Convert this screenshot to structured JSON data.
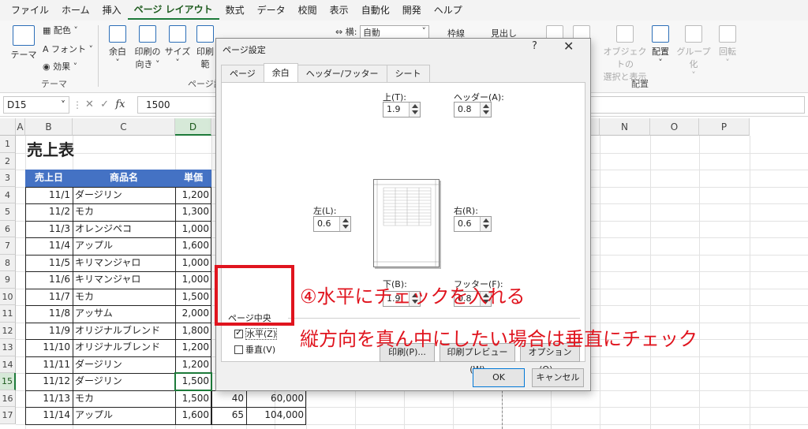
{
  "menu": [
    "ファイル",
    "ホーム",
    "挿入",
    "ページ レイアウト",
    "数式",
    "データ",
    "校閲",
    "表示",
    "自動化",
    "開発",
    "ヘルプ"
  ],
  "menu_active_index": 3,
  "ribbon": {
    "theme": "テーマ",
    "colors": "配色",
    "fonts": "フォント",
    "effects": "効果",
    "theme_group": "テーマ",
    "margins": "余白",
    "orientation_1": "印刷の",
    "orientation_2": "向き",
    "size": "サイズ",
    "print_area": "印刷範",
    "page_setup_group": "ページ設",
    "width_label": "横:",
    "width_value": "自動",
    "gridlines": "枠線",
    "headings": "見出し",
    "selection_pane_1": "オブジェクトの",
    "selection_pane_2": "選択と表示",
    "align": "配置",
    "group": "グループ化",
    "rotate": "回転",
    "arrange_group": "配置"
  },
  "formula_bar": {
    "name_box": "D15",
    "fx": "fx",
    "content": "1500"
  },
  "columns": [
    "A",
    "B",
    "C",
    "D",
    "",
    "",
    "",
    "",
    "",
    "",
    "",
    "",
    "M",
    "N",
    "O",
    "P"
  ],
  "rows": [
    "1",
    "2",
    "3",
    "4",
    "5",
    "6",
    "7",
    "8",
    "9",
    "10",
    "11",
    "12",
    "13",
    "14",
    "15",
    "16",
    "17"
  ],
  "sheet": {
    "title": "売上表",
    "headers": [
      "売上日",
      "商品名",
      "単価"
    ],
    "data": [
      [
        "11/1",
        "ダージリン",
        "1,200"
      ],
      [
        "11/2",
        "モカ",
        "1,300"
      ],
      [
        "11/3",
        "オレンジペコ",
        "1,000"
      ],
      [
        "11/4",
        "アップル",
        "1,600"
      ],
      [
        "11/5",
        "キリマンジャロ",
        "1,000"
      ],
      [
        "11/6",
        "キリマンジャロ",
        "1,000"
      ],
      [
        "11/7",
        "モカ",
        "1,500"
      ],
      [
        "11/8",
        "アッサム",
        "2,000"
      ],
      [
        "11/9",
        "オリジナルブレンド",
        "1,800"
      ],
      [
        "11/10",
        "オリジナルブレンド",
        "1,200"
      ],
      [
        "11/11",
        "ダージリン",
        "1,200"
      ],
      [
        "11/12",
        "ダージリン",
        "1,500"
      ],
      [
        "11/13",
        "モカ",
        "1,500"
      ],
      [
        "11/14",
        "アップル",
        "1,600"
      ]
    ],
    "extra": [
      {
        "row": 16,
        "qty": "40",
        "amount": "60,000"
      },
      {
        "row": 17,
        "qty": "65",
        "amount": "104,000"
      }
    ]
  },
  "dialog": {
    "title": "ページ設定",
    "help": "?",
    "close": "✕",
    "tabs": [
      "ページ",
      "余白",
      "ヘッダー/フッター",
      "シート"
    ],
    "active_tab": 1,
    "top_label": "上(T):",
    "top_value": "1.9",
    "header_label": "ヘッダー(A):",
    "header_value": "0.8",
    "left_label": "左(L):",
    "left_value": "0.6",
    "right_label": "右(R):",
    "right_value": "0.6",
    "bottom_label": "下(B):",
    "bottom_value": "1.9",
    "footer_label": "フッター(F):",
    "footer_value": "0.8",
    "center_group": "ページ中央",
    "horizontal": "水平(Z)",
    "horizontal_checked": true,
    "vertical": "垂直(V)",
    "vertical_checked": false,
    "print_btn": "印刷(P)...",
    "preview_btn": "印刷プレビュー(W)",
    "options_btn": "オプション(O)...",
    "ok": "OK",
    "cancel": "キャンセル"
  },
  "annotation": {
    "line1": "④水平にチェックを入れる",
    "line2": "縦方向を真ん中にしたい場合は垂直にチェック",
    "color": "#e0141e"
  }
}
